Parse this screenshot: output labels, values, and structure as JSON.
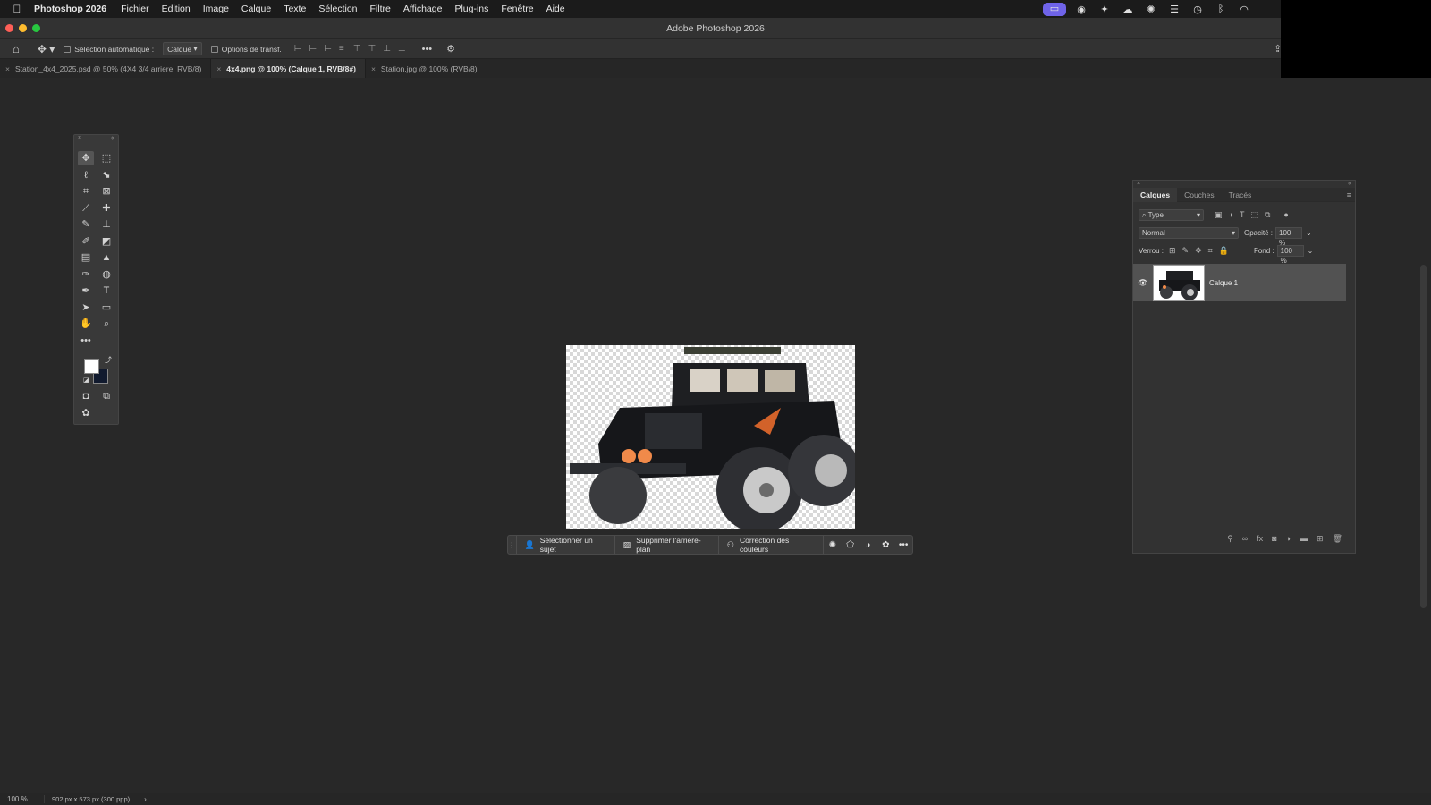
{
  "menubar": {
    "app_name": "Photoshop 2026",
    "items": [
      "Fichier",
      "Edition",
      "Image",
      "Calque",
      "Texte",
      "Sélection",
      "Filtre",
      "Affichage",
      "Plug-ins",
      "Fenêtre",
      "Aide"
    ]
  },
  "window": {
    "title": "Adobe Photoshop 2026"
  },
  "options_bar": {
    "auto_select_label": "Sélection automatique :",
    "auto_select_target": "Calque",
    "transform_options_label": "Options de transf."
  },
  "doc_tabs": [
    {
      "label": "Station_4x4_2025.psd @ 50% (4X4 3/4 arriere, RVB/8)",
      "active": false
    },
    {
      "label": "4x4.png @ 100% (Calque 1, RVB/8#)",
      "active": true
    },
    {
      "label": "Station.jpg @ 100% (RVB/8)",
      "active": false
    }
  ],
  "taskbar": {
    "select_subject": "Sélectionner un sujet",
    "remove_background": "Supprimer l'arrière-plan",
    "color_correction": "Correction des couleurs"
  },
  "layers_panel": {
    "tabs": [
      {
        "label": "Calques",
        "active": true
      },
      {
        "label": "Couches",
        "active": false
      },
      {
        "label": "Tracés",
        "active": false
      }
    ],
    "filter_label": "Type",
    "blend_mode": "Normal",
    "opacity_label": "Opacité :",
    "opacity_value": "100 %",
    "lock_label": "Verrou :",
    "fill_label": "Fond :",
    "fill_value": "100 %",
    "layers": [
      {
        "name": "Calque 1",
        "visible": true
      }
    ]
  },
  "status_bar": {
    "zoom": "100 %",
    "doc_info": "902 px x 573 px (300 ppp)"
  },
  "colors": {
    "foreground": "#ffffff",
    "background": "#111a2e",
    "active_status_icon": "#6f63e8"
  }
}
